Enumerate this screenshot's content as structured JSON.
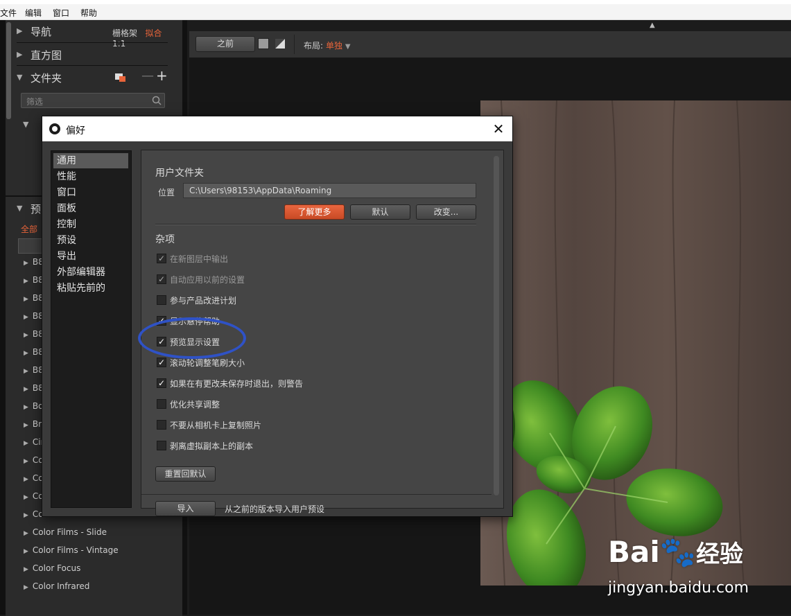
{
  "menu": [
    "文件",
    "编辑",
    "窗口",
    "帮助"
  ],
  "left_panel": {
    "nav_label": "导航",
    "nav_opts": {
      "grid": "栅格架",
      "fit": "拟合",
      "one_to_one": "1:1"
    },
    "histogram_label": "直方图",
    "folders_label": "文件夹",
    "filter_placeholder": "筛选",
    "presets_label": "预",
    "presets_all": "全部",
    "preset_items": [
      "B8",
      "B8",
      "B8",
      "B8",
      "B8",
      "B8",
      "B8",
      "B8",
      "Bo",
      "Br",
      "Cir",
      "Co",
      "Co",
      "Color Films - Print",
      "Color Films - Print - Low Contrast",
      "Color Films - Slide",
      "Color Films - Vintage",
      "Color Focus",
      "Color Infrared"
    ]
  },
  "toolbar": {
    "before": "之前",
    "layout_label": "布局:",
    "layout_value": "单独"
  },
  "dialog": {
    "title": "偏好",
    "categories": [
      "通用",
      "性能",
      "窗口",
      "面板",
      "控制",
      "预设",
      "导出",
      "外部编辑器",
      "粘贴先前的"
    ],
    "selected_category": "通用",
    "user_folder_title": "用户文件夹",
    "location_label": "位置",
    "location_value": "C:\\Users\\98153\\AppData\\Roaming",
    "buttons": {
      "learn_more": "了解更多",
      "default": "默认",
      "change": "改变..."
    },
    "misc_title": "杂项",
    "options": [
      {
        "label": "在新图层中输出",
        "checked": true,
        "enabled": false
      },
      {
        "label": "自动应用以前的设置",
        "checked": true,
        "enabled": false
      },
      {
        "label": "参与产品改进计划",
        "checked": false,
        "enabled": true
      },
      {
        "label": "显示悬停帮助",
        "checked": true,
        "enabled": true
      },
      {
        "label": "预览显示设置",
        "checked": true,
        "enabled": true
      },
      {
        "label": "滚动轮调整笔刷大小",
        "checked": true,
        "enabled": true
      },
      {
        "label": "如果在有更改未保存时退出，则警告",
        "checked": true,
        "enabled": true
      },
      {
        "label": "优化共享调整",
        "checked": false,
        "enabled": true
      },
      {
        "label": "不要从相机卡上复制照片",
        "checked": false,
        "enabled": true
      },
      {
        "label": "剥离虚拟副本上的副本",
        "checked": false,
        "enabled": true
      }
    ],
    "reset_button": "重置回默认",
    "import_button": "导入",
    "import_text": "从之前的版本导入用户预设"
  },
  "watermark": {
    "brand": "Bai",
    "brand2": "经验",
    "url": "jingyan.baidu.com"
  }
}
